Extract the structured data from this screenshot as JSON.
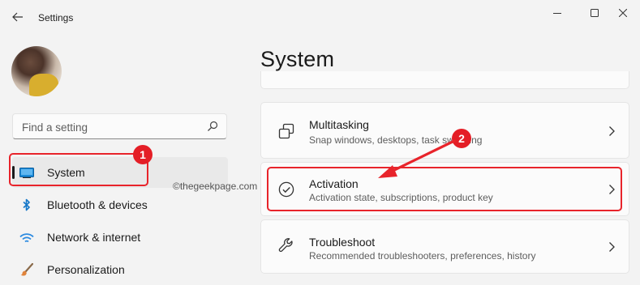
{
  "window": {
    "title": "Settings",
    "controls": [
      "minimize",
      "maximize",
      "close"
    ]
  },
  "search": {
    "placeholder": "Find a setting"
  },
  "sidebar": {
    "items": [
      {
        "label": "System",
        "icon": "system-icon",
        "selected": true
      },
      {
        "label": "Bluetooth & devices",
        "icon": "bluetooth-icon"
      },
      {
        "label": "Network & internet",
        "icon": "wifi-icon"
      },
      {
        "label": "Personalization",
        "icon": "brush-icon"
      }
    ]
  },
  "main": {
    "title": "System",
    "cards": [
      {
        "title": "Multitasking",
        "subtitle": "Snap windows, desktops, task switching",
        "icon": "multitasking-icon"
      },
      {
        "title": "Activation",
        "subtitle": "Activation state, subscriptions, product key",
        "icon": "activation-check-icon"
      },
      {
        "title": "Troubleshoot",
        "subtitle": "Recommended troubleshooters, preferences, history",
        "icon": "wrench-icon"
      }
    ]
  },
  "annotations": {
    "badge1": "1",
    "badge2": "2",
    "watermark": "©thegeekpage.com",
    "color": "#e8242b"
  },
  "colors": {
    "background": "#f3f3f3",
    "card": "#fbfbfb",
    "accent": "#0067c0"
  }
}
